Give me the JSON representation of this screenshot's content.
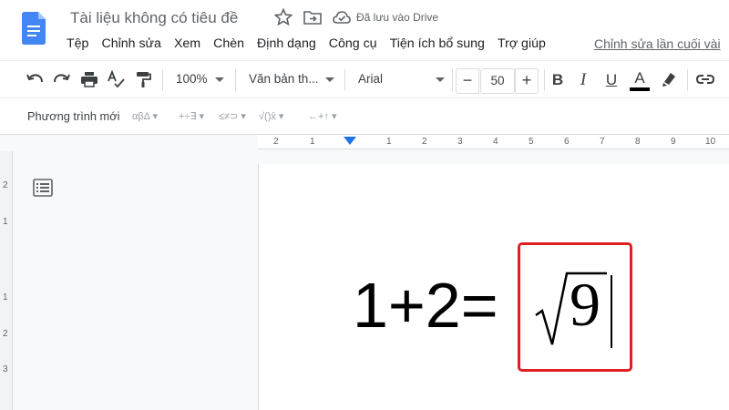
{
  "header": {
    "doc_title": "Tài liệu không có tiêu đề",
    "saved_status": "Đã lưu vào Drive",
    "last_edit": "Chỉnh sửa lần cuối vài"
  },
  "menu": [
    "Tệp",
    "Chỉnh sửa",
    "Xem",
    "Chèn",
    "Định dạng",
    "Công cụ",
    "Tiện ích bổ sung",
    "Trợ giúp"
  ],
  "toolbar": {
    "zoom": "100%",
    "style": "Văn bản th...",
    "font": "Arial",
    "font_size": "50",
    "minus": "−",
    "plus": "+",
    "bold": "B",
    "italic": "I",
    "underline": "U",
    "text_color": "A"
  },
  "equation_toolbar": {
    "new_equation": "Phương trình mới",
    "groups": [
      "αβΔ",
      "+÷∃",
      "≤≠⊃",
      "√()x̄",
      "←+↑"
    ]
  },
  "ruler": {
    "h_numbers": [
      "2",
      "1",
      "1",
      "2",
      "3",
      "4",
      "5",
      "6",
      "7",
      "8",
      "9",
      "10"
    ],
    "v_numbers": [
      "2",
      "1",
      "1",
      "2",
      "3"
    ]
  },
  "document": {
    "equation_lhs": "1+2=",
    "radicand": "9"
  },
  "icons": {
    "logo": "docs-logo-icon",
    "star": "star-icon",
    "move": "folder-move-icon",
    "cloud": "cloud-check-icon",
    "undo": "undo-icon",
    "redo": "redo-icon",
    "print": "print-icon",
    "spell": "spellcheck-icon",
    "paint": "paint-format-icon",
    "highlight": "highlighter-icon",
    "link": "link-icon",
    "outline": "document-outline-icon"
  },
  "colors": {
    "brand_blue": "#4285f4",
    "highlight_red": "#e02020",
    "ruler_marker": "#1a73e8"
  }
}
